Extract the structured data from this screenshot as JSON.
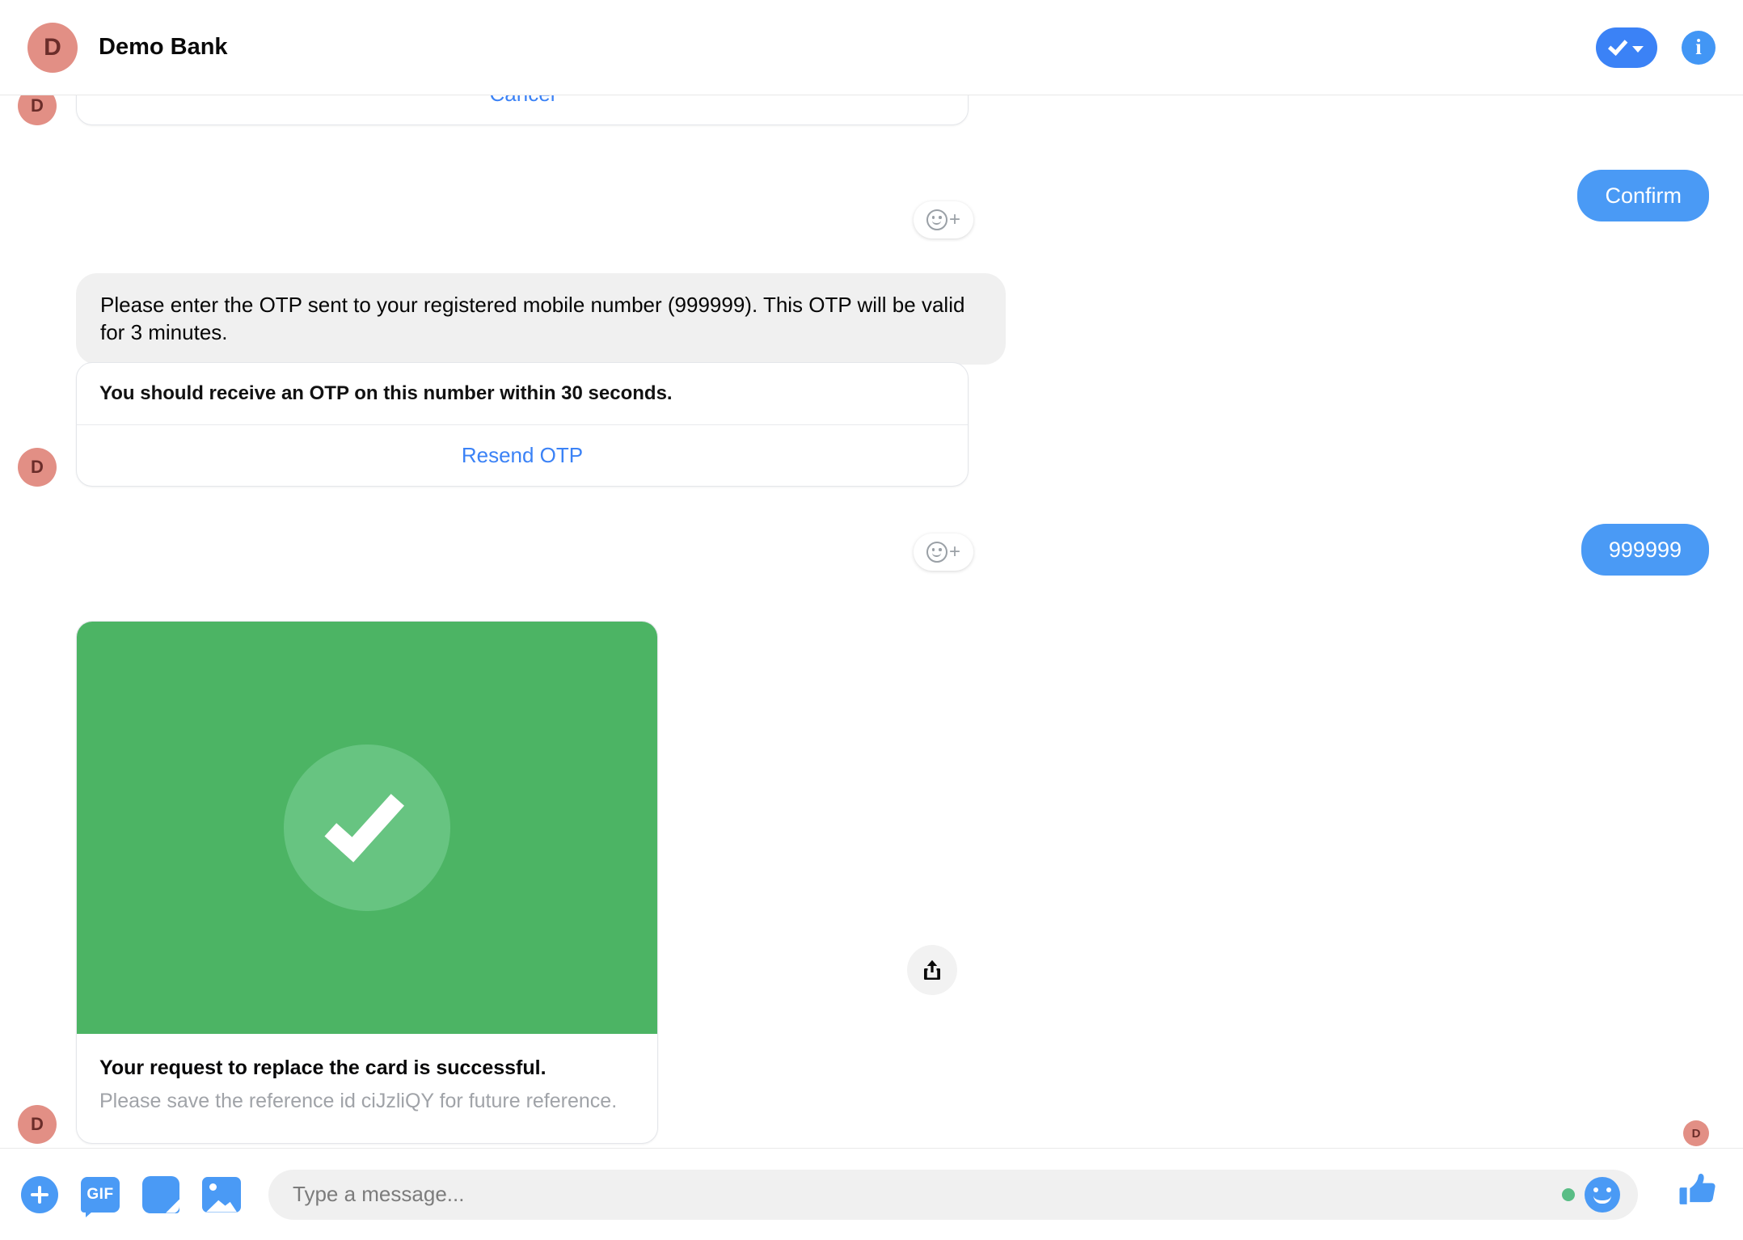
{
  "header": {
    "avatar_initial": "D",
    "title": "Demo Bank",
    "status_icon": "check-pill-icon",
    "info_icon": "info-icon",
    "accent_blue": "#3b82f6"
  },
  "conversation": [
    {
      "id": "cancel-card",
      "sender": "bot",
      "avatar_initial": "D",
      "type": "card",
      "button_label": "Cancel",
      "reaction_icon": "add-reaction-icon"
    },
    {
      "id": "confirm-message",
      "sender": "user",
      "type": "bubble",
      "text": "Confirm"
    },
    {
      "id": "otp-instruction",
      "sender": "bot",
      "type": "bubble",
      "text": "Please enter the OTP sent to your registered mobile number (999999). This OTP will be valid for 3 minutes."
    },
    {
      "id": "resend-otp-card",
      "sender": "bot",
      "avatar_initial": "D",
      "type": "card",
      "title": "You should receive an OTP on this number within 30 seconds.",
      "button_label": "Resend OTP",
      "reaction_icon": "add-reaction-icon"
    },
    {
      "id": "otp-entered",
      "sender": "user",
      "type": "bubble",
      "text": "999999"
    },
    {
      "id": "success-card",
      "sender": "bot",
      "avatar_initial": "D",
      "type": "media-card",
      "media_icon": "success-check-icon",
      "media_bg": "#4cb464",
      "media_circle": "#67c481",
      "title": "Your request to replace the card is successful.",
      "subtitle": "Please save the reference id ciJzliQY for future reference.",
      "share_icon": "share-icon",
      "reaction_icon": "add-reaction-icon"
    }
  ],
  "read_receipt": {
    "avatar_initial": "D"
  },
  "composer": {
    "plus_icon": "plus-circle-icon",
    "gif_label": "GIF",
    "gif_icon": "gif-icon",
    "sticker_icon": "sticker-icon",
    "image_icon": "image-icon",
    "placeholder": "Type a message...",
    "value": "",
    "status_dot_color": "#59bd85",
    "emoji_icon": "emoji-smiley-icon",
    "like_icon": "thumbs-up-icon",
    "like_glyph": "👍"
  }
}
